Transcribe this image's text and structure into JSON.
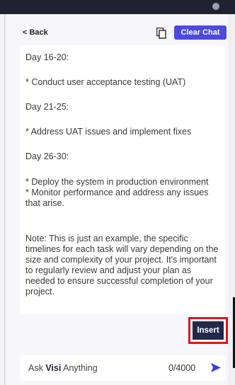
{
  "header": {
    "back_label": "< Back",
    "clear_chat_label": "Clear Chat"
  },
  "message": {
    "lines": [
      "Day 16-20:",
      "* Conduct user acceptance testing (UAT)",
      "Day 21-25:",
      "* Address UAT issues and implement fixes",
      "Day 26-30:",
      "* Deploy the system in production environment\n* Monitor performance and address any issues that arise.",
      "Note: This is just an example, the specific timelines for each task will vary depending on the size and complexity of your project. It's important to regularly review and adjust your plan as needed to ensure successful completion of your project."
    ]
  },
  "insert_label": "Insert",
  "input": {
    "placeholder_prefix": "Ask ",
    "placeholder_brand": "Visi",
    "placeholder_suffix": " Anything",
    "counter": "0/4000"
  },
  "colors": {
    "accent": "#4b49e0",
    "insert_bg": "#23294a",
    "highlight": "#d51822",
    "topbar": "#1e2233"
  },
  "icons": {
    "copy": "copy-icon",
    "send": "send-icon"
  }
}
